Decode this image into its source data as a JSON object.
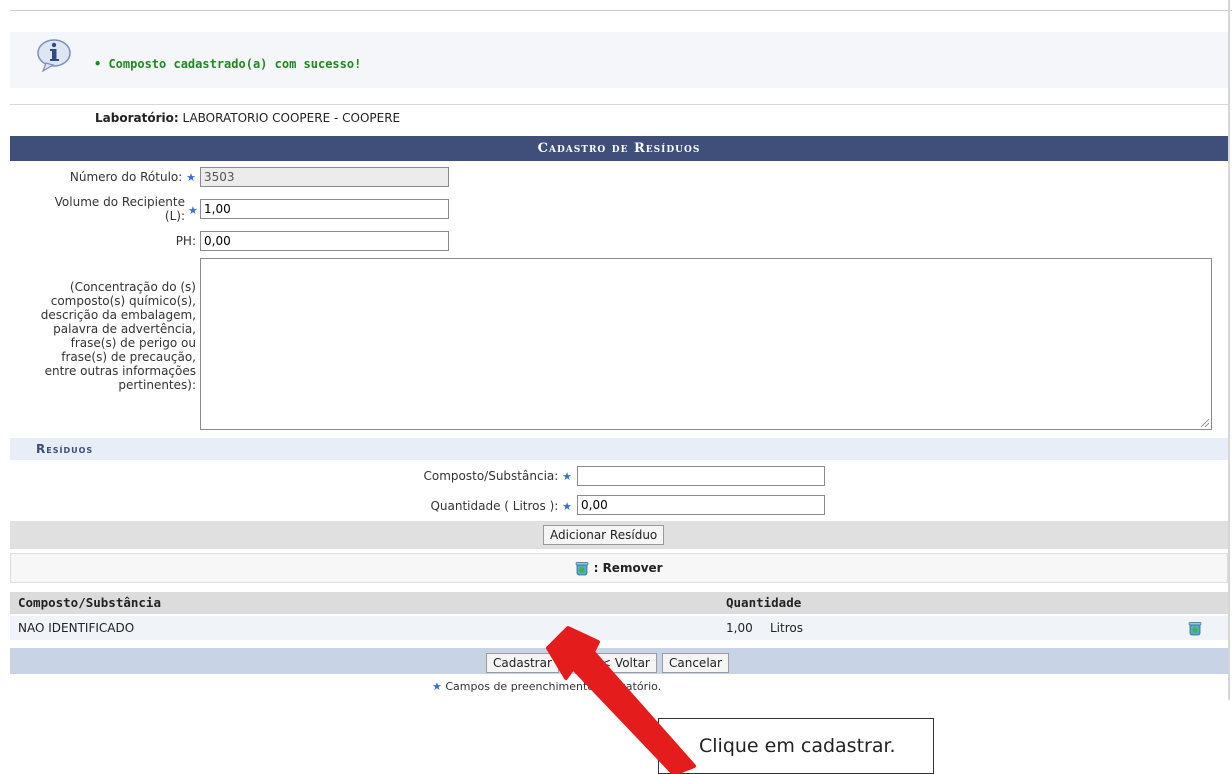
{
  "message": {
    "text": "Composto cadastrado(a) com sucesso!",
    "icon": "info-icon"
  },
  "lab": {
    "label": "Laboratório:",
    "value": "LABORATORIO COOPERE - COOPERE"
  },
  "form": {
    "title": "Cadastro de Resíduos",
    "rotulo_label": "Número do Rótulo:",
    "rotulo_value": "3503",
    "volume_label_1": "Volume do Recipiente",
    "volume_label_2": "(L):",
    "volume_value": "1,00",
    "ph_label": "PH:",
    "ph_value": "0,00",
    "desc_label": [
      "(Concentração do (s)",
      "composto(s) químico(s),",
      "descrição da embalagem,",
      "palavra de advertência,",
      "frase(s) de perigo ou",
      "frase(s) de precaução,",
      "entre outras informações",
      "pertinentes):"
    ]
  },
  "residuos": {
    "title": "Resíduos",
    "composto_label": "Composto/Substância:",
    "composto_value": "",
    "quantidade_label": "Quantidade ( Litros ):",
    "quantidade_value": "0,00",
    "add_button": "Adicionar Resíduo"
  },
  "legend": {
    "remove_label": ": Remover"
  },
  "table": {
    "columns": [
      "Composto/Substância",
      "Quantidade"
    ],
    "rows": [
      {
        "composto": "NAO IDENTIFICADO",
        "quantidade": "1,00",
        "unidade": "Litros"
      }
    ]
  },
  "actions": {
    "cadastrar": "Cadastrar",
    "voltar": "<< Voltar",
    "cancelar": "Cancelar"
  },
  "required_note": "Campos de preenchimento obrigatório.",
  "callout": {
    "text": "Clique em cadastrar."
  },
  "colors": {
    "header_bg": "#3f4f7a",
    "success_text": "#1f8a1f",
    "arrow": "#e51c1c",
    "required_star": "#3a6fd1"
  }
}
